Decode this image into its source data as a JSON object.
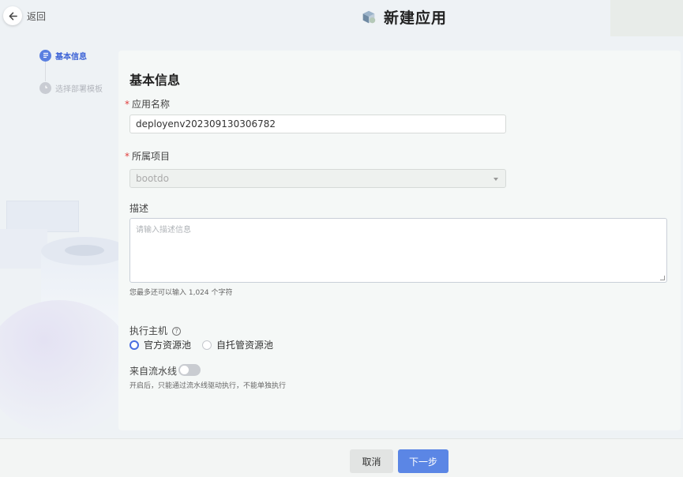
{
  "header": {
    "back_label": "返回",
    "title": "新建应用",
    "app_icon": "cube-stack-icon"
  },
  "steps": [
    {
      "label": "基本信息",
      "state": "active"
    },
    {
      "label": "选择部署模板",
      "state": "pending"
    }
  ],
  "form": {
    "section_title": "基本信息",
    "required_mark": "*",
    "app_name": {
      "label": "应用名称",
      "value": "deployenv202309130306782"
    },
    "project": {
      "label": "所属项目",
      "value": "bootdo"
    },
    "description": {
      "label": "描述",
      "placeholder": "请输入描述信息",
      "hint": "您最多还可以输入 1,024 个字符"
    },
    "executor": {
      "label": "执行主机",
      "help": "?",
      "options": [
        {
          "label": "官方资源池",
          "checked": true
        },
        {
          "label": "自托管资源池",
          "checked": false
        }
      ]
    },
    "pipeline": {
      "label": "来自流水线",
      "enabled": false,
      "hint": "开启后，只能通过流水线驱动执行，不能单独执行"
    }
  },
  "footer": {
    "cancel_label": "取消",
    "next_label": "下一步"
  },
  "colors": {
    "primary": "#5b86e5",
    "required": "#e03c3c",
    "step_active": "#3d63d6"
  }
}
